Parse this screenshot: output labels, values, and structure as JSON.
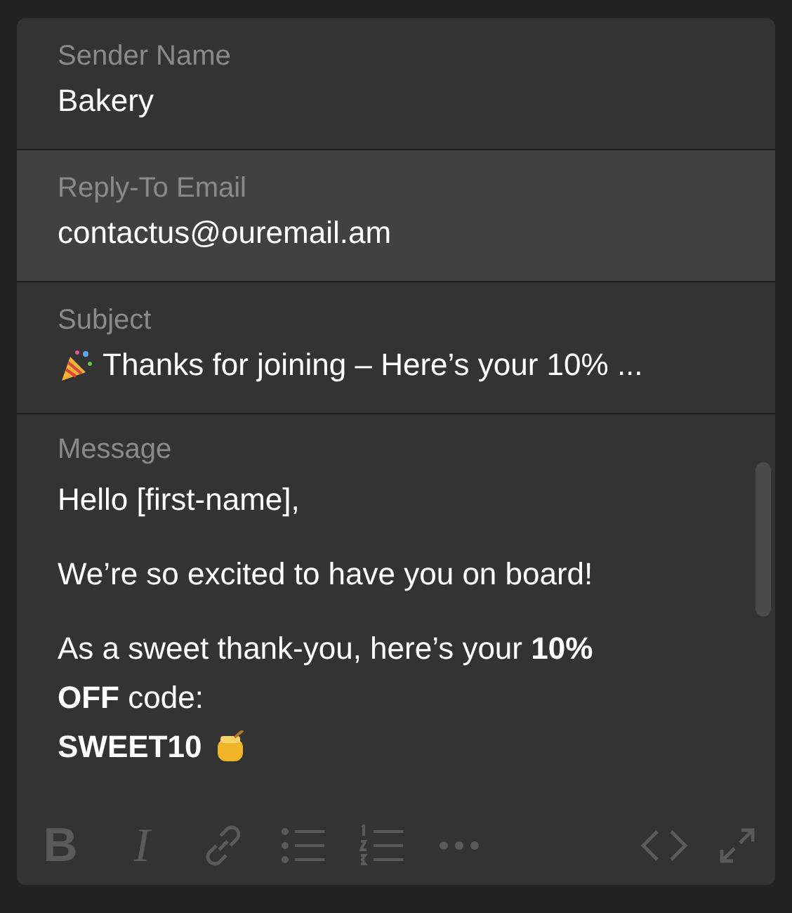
{
  "fields": [
    {
      "label": "Sender Name",
      "value": "Bakery",
      "focused": false
    },
    {
      "label": "Reply-To Email",
      "value": "contactus@ouremail.am",
      "focused": true
    },
    {
      "label": "Subject",
      "value": "Thanks for joining – Here’s your 10% ...",
      "focused": false,
      "leading_icon": true
    }
  ],
  "message": {
    "label": "Message",
    "paragraphs": [
      {
        "lines": [
          {
            "text": "Hello [first-name],"
          }
        ]
      },
      {
        "lines": [
          {
            "text": "We’re so excited to have you on board!"
          }
        ]
      },
      {
        "lines": [
          {
            "text": "As a sweet thank-you, here’s your **10%**"
          },
          {
            "text": "**OFF** code:"
          },
          {
            "text": "**SWEET10**",
            "trailing_icon": true
          }
        ]
      }
    ]
  },
  "toolbar": {
    "disabled": true,
    "items": [
      {
        "kind": "bold",
        "label": "B"
      },
      {
        "kind": "italic",
        "label": "I"
      },
      {
        "kind": "link"
      },
      {
        "kind": "bullet-list"
      },
      {
        "kind": "numbered-list"
      },
      {
        "kind": "more"
      },
      {
        "kind": "code"
      },
      {
        "kind": "expand"
      }
    ]
  }
}
